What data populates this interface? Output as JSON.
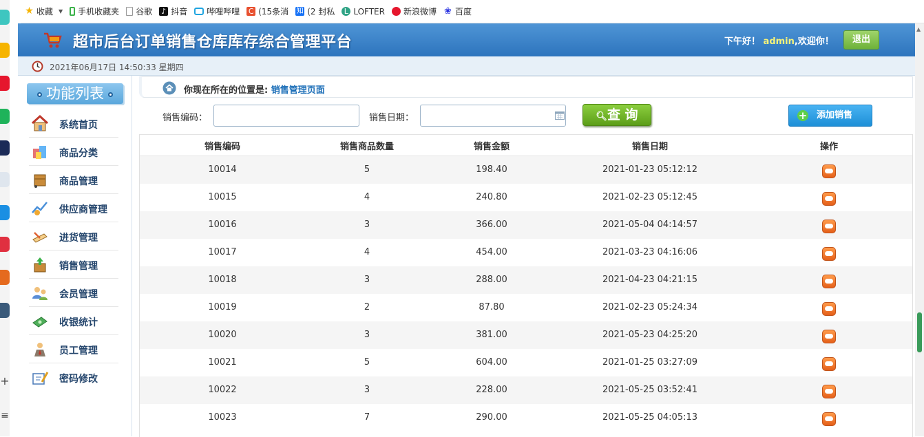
{
  "bookmarks": [
    {
      "label": "收藏",
      "icon": "star-icon",
      "color": "#f6b400"
    },
    {
      "label": "手机收藏夹",
      "icon": "phone-icon",
      "color": "#3bb24a"
    },
    {
      "label": "谷歌",
      "icon": "page-icon",
      "color": "#999999"
    },
    {
      "label": "抖音",
      "icon": "tiktok-icon",
      "color": "#111111"
    },
    {
      "label": "哔哩哔哩",
      "icon": "bilibili-icon",
      "color": "#21a5e0"
    },
    {
      "label": "(15条消",
      "icon": "csdn-icon",
      "color": "#e8502f"
    },
    {
      "label": "(2 封私",
      "icon": "zhihu-icon",
      "color": "#1772f6"
    },
    {
      "label": "LOFTER",
      "icon": "lofter-icon",
      "color": "#2fa385"
    },
    {
      "label": "新浪微博",
      "icon": "weibo-icon",
      "color": "#e6162d"
    },
    {
      "label": "百度",
      "icon": "baidu-icon",
      "color": "#2932e1"
    }
  ],
  "header": {
    "title": "超市后台订单销售仓库库存综合管理平台",
    "greeting_prefix": "下午好！",
    "username": "admin",
    "greeting_suffix": ",欢迎你！",
    "logout_label": "退出"
  },
  "datetime": "2021年06月17日 14:50:33 星期四",
  "sidebar": {
    "title": "功能列表",
    "items": [
      {
        "label": "系统首页",
        "icon": "home-icon"
      },
      {
        "label": "商品分类",
        "icon": "category-icon"
      },
      {
        "label": "商品管理",
        "icon": "goods-icon"
      },
      {
        "label": "供应商管理",
        "icon": "supplier-icon"
      },
      {
        "label": "进货管理",
        "icon": "purchase-icon"
      },
      {
        "label": "销售管理",
        "icon": "sales-icon"
      },
      {
        "label": "会员管理",
        "icon": "member-icon"
      },
      {
        "label": "收银统计",
        "icon": "cashier-icon"
      },
      {
        "label": "员工管理",
        "icon": "staff-icon"
      },
      {
        "label": "密码修改",
        "icon": "password-icon"
      }
    ]
  },
  "location": {
    "prefix": "你现在所在的位置是:",
    "page": "销售管理页面"
  },
  "search": {
    "code_label": "销售编码：",
    "code_value": "",
    "date_label": "销售日期：",
    "date_value": "",
    "query_label": "查 询",
    "add_label": "添加销售"
  },
  "table": {
    "columns": [
      "销售编码",
      "销售商品数量",
      "销售金额",
      "销售日期",
      "操作"
    ],
    "rows": [
      [
        "10014",
        "5",
        "198.40",
        "2021-01-23 05:12:12"
      ],
      [
        "10015",
        "4",
        "240.80",
        "2021-02-23 05:12:45"
      ],
      [
        "10016",
        "3",
        "366.00",
        "2021-05-04 04:14:57"
      ],
      [
        "10017",
        "4",
        "454.00",
        "2021-03-23 04:16:06"
      ],
      [
        "10018",
        "3",
        "288.00",
        "2021-04-23 04:21:15"
      ],
      [
        "10019",
        "2",
        "87.80",
        "2021-02-23 05:24:34"
      ],
      [
        "10020",
        "3",
        "381.00",
        "2021-05-23 04:25:20"
      ],
      [
        "10021",
        "5",
        "604.00",
        "2021-01-25 03:27:09"
      ],
      [
        "10022",
        "3",
        "228.00",
        "2021-05-25 03:52:41"
      ],
      [
        "10023",
        "7",
        "290.00",
        "2021-05-25 04:05:13"
      ]
    ]
  },
  "colors": {
    "header_blue": "#2d74bd",
    "query_green": "#5c9e18",
    "add_blue": "#1d8fd7",
    "link_blue": "#1d6fb8",
    "op_orange": "#e5601a"
  }
}
